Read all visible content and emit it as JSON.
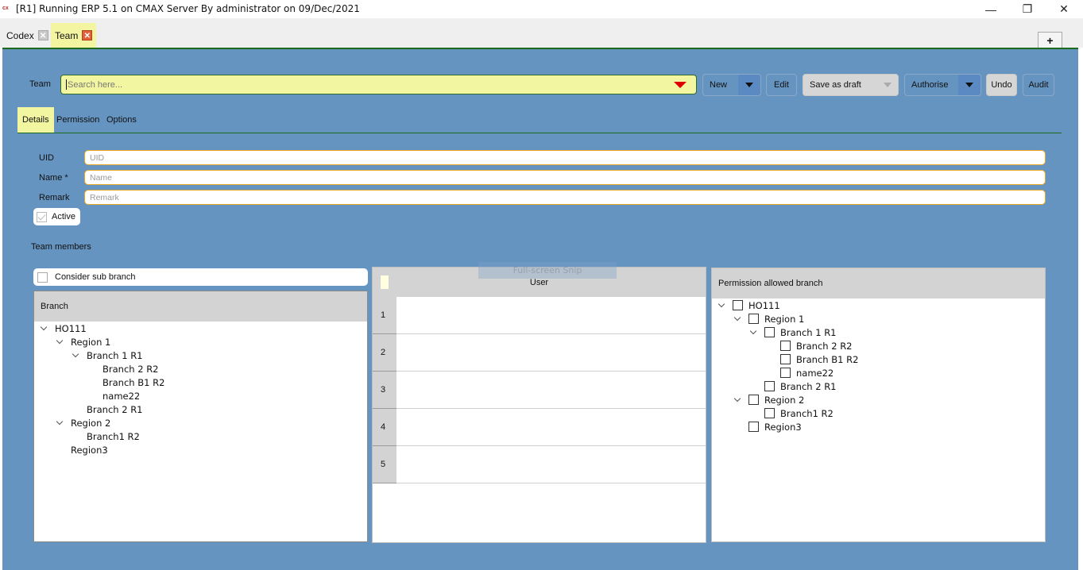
{
  "window": {
    "app_icon_text": "cx",
    "title": "[R1] Running ERP 5.1 on CMAX Server By administrator on 09/Dec/2021",
    "controls": {
      "minimize": "—",
      "restore": "❐",
      "close": "✕"
    }
  },
  "doc_tabs": [
    {
      "label": "Codex",
      "close": "✕",
      "active": false
    },
    {
      "label": "Team",
      "close": "✕",
      "active": true
    }
  ],
  "new_tab_label": "+",
  "toolbar": {
    "team_label": "Team",
    "search_placeholder": "Search here...",
    "new_label": "New",
    "edit_label": "Edit",
    "save_draft_label": "Save as draft",
    "authorise_label": "Authorise",
    "undo_label": "Undo",
    "audit_label": "Audit"
  },
  "tabs": [
    {
      "label": "Details",
      "active": true
    },
    {
      "label": "Permission",
      "active": false
    },
    {
      "label": "Options",
      "active": false
    }
  ],
  "form": {
    "uid": {
      "label": "UID",
      "placeholder": "UID",
      "value": ""
    },
    "name": {
      "label": "Name *",
      "placeholder": "Name",
      "value": ""
    },
    "remark": {
      "label": "Remark",
      "placeholder": "Remark",
      "value": ""
    },
    "active": {
      "label": "Active",
      "checked": true,
      "disabled": true
    }
  },
  "team_members": {
    "title": "Team members",
    "consider_sub_branch": {
      "label": "Consider sub branch",
      "checked": false
    },
    "branch_panel": {
      "header": "Branch",
      "tree": [
        {
          "label": "HO111",
          "level": 0,
          "expanded": true,
          "has_children": true
        },
        {
          "label": "Region 1",
          "level": 1,
          "expanded": true,
          "has_children": true
        },
        {
          "label": "Branch 1 R1",
          "level": 2,
          "expanded": true,
          "has_children": true
        },
        {
          "label": "Branch 2 R2",
          "level": 3,
          "has_children": false
        },
        {
          "label": "Branch B1 R2",
          "level": 3,
          "has_children": false
        },
        {
          "label": "name22",
          "level": 3,
          "has_children": false
        },
        {
          "label": "Branch 2 R1",
          "level": 2,
          "has_children": false
        },
        {
          "label": "Region 2",
          "level": 1,
          "expanded": true,
          "has_children": true
        },
        {
          "label": "Branch1 R2",
          "level": 2,
          "has_children": false
        },
        {
          "label": "Region3",
          "level": 1,
          "has_children": false
        }
      ]
    },
    "user_grid": {
      "header": "User",
      "rows": [
        {
          "num": "1",
          "user": ""
        },
        {
          "num": "2",
          "user": ""
        },
        {
          "num": "3",
          "user": ""
        },
        {
          "num": "4",
          "user": ""
        },
        {
          "num": "5",
          "user": ""
        }
      ]
    },
    "permission_panel": {
      "header": "Permission allowed branch",
      "tree": [
        {
          "label": "HO111",
          "level": 0,
          "expanded": true,
          "has_children": true,
          "checked": false
        },
        {
          "label": "Region 1",
          "level": 1,
          "expanded": true,
          "has_children": true,
          "checked": false
        },
        {
          "label": "Branch 1 R1",
          "level": 2,
          "expanded": true,
          "has_children": true,
          "checked": false
        },
        {
          "label": "Branch 2 R2",
          "level": 3,
          "has_children": false,
          "checked": false
        },
        {
          "label": "Branch B1 R2",
          "level": 3,
          "has_children": false,
          "checked": false
        },
        {
          "label": "name22",
          "level": 3,
          "has_children": false,
          "checked": false
        },
        {
          "label": "Branch 2 R1",
          "level": 2,
          "has_children": false,
          "checked": false
        },
        {
          "label": "Region 2",
          "level": 1,
          "expanded": true,
          "has_children": true,
          "checked": false
        },
        {
          "label": "Branch1 R2",
          "level": 2,
          "has_children": false,
          "checked": false
        },
        {
          "label": "Region3",
          "level": 1,
          "has_children": false,
          "checked": false
        }
      ]
    }
  },
  "overlay": {
    "snip_label": "Full-screen Snip"
  },
  "colors": {
    "main_bg": "#6694c0",
    "highlight_yellow": "#f3f6a0",
    "accent_green": "#1d6a1d",
    "input_border": "#e8a825",
    "dropdown_red": "#e00000"
  }
}
